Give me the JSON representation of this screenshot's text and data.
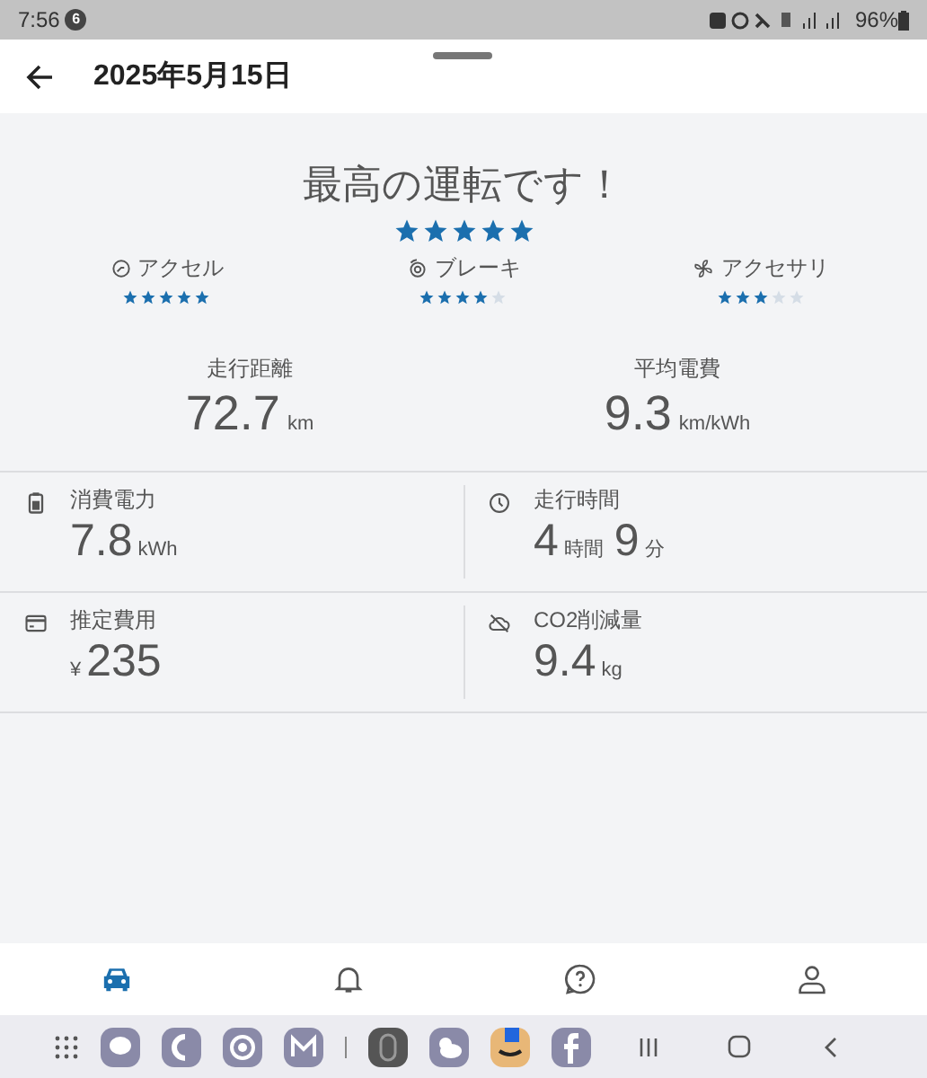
{
  "status_bar": {
    "time": "7:56",
    "notification_count": "6",
    "battery": "96%"
  },
  "header": {
    "title": "2025年5月15日"
  },
  "rating": {
    "headline": "最高の運転です！",
    "stars": 5
  },
  "categories": [
    {
      "label": "アクセル",
      "stars": 5
    },
    {
      "label": "ブレーキ",
      "stars": 4
    },
    {
      "label": "アクセサリ",
      "stars": 3
    }
  ],
  "summary": [
    {
      "label": "走行距離",
      "parts": [
        {
          "value": "72.7",
          "unit": "km"
        }
      ]
    },
    {
      "label": "平均電費",
      "parts": [
        {
          "value": "9.3",
          "unit": "km/kWh"
        }
      ]
    }
  ],
  "metrics": [
    {
      "label": "消費電力",
      "parts": [
        {
          "value": "7.8",
          "unit": "kWh"
        }
      ]
    },
    {
      "label": "走行時間",
      "parts": [
        {
          "value": "4",
          "unit": "時間"
        },
        {
          "value": "9",
          "unit": "分"
        }
      ]
    },
    {
      "label": "推定費用",
      "prefix": "¥",
      "parts": [
        {
          "value": "235"
        }
      ]
    },
    {
      "label": "CO2削減量",
      "parts": [
        {
          "value": "9.4",
          "unit": "kg"
        }
      ]
    }
  ],
  "bottom_nav": [
    {
      "selected": true
    },
    {
      "selected": false
    },
    {
      "selected": false
    },
    {
      "selected": false
    }
  ]
}
